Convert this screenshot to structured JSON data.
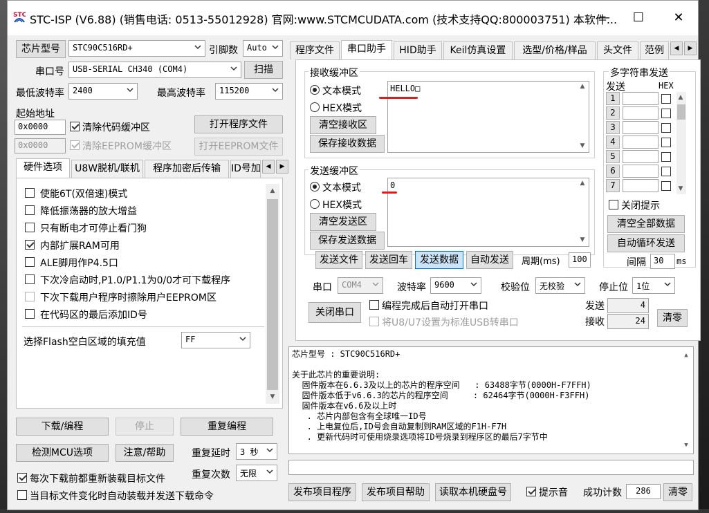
{
  "window": {
    "title": "STC-ISP (V6.88) (销售电话: 0513-55012928) 官网:www.STCMCUDATA.com  (技术支持QQ:800003751) 本软件...",
    "minimize_glyph": "—",
    "maximize_glyph": "☐",
    "close_glyph": "✕"
  },
  "left": {
    "chip_label": "芯片型号",
    "chip_value": "STC90C516RD+",
    "pins_label": "引脚数",
    "pins_value": "Auto",
    "port_label": "串口号",
    "port_value": "USB-SERIAL CH340 (COM4)",
    "scan_button": "扫描",
    "min_baud_label": "最低波特率",
    "min_baud_value": "2400",
    "max_baud_label": "最高波特率",
    "max_baud_value": "115200",
    "start_addr_label": "起始地址",
    "addr1_value": "0x0000",
    "clear_code_label": "清除代码缓冲区",
    "open_program_button": "打开程序文件",
    "addr2_value": "0x0000",
    "clear_eeprom_label": "清除EEPROM缓冲区",
    "open_eeprom_button": "打开EEPROM文件",
    "tabs": [
      "硬件选项",
      "U8W脱机/联机",
      "程序加密后传输",
      "ID号加"
    ],
    "options": [
      {
        "label": "使能6T(双倍速)模式",
        "checked": false,
        "disabled": false
      },
      {
        "label": "降低振荡器的放大增益",
        "checked": false,
        "disabled": false
      },
      {
        "label": "只有断电才可停止看门狗",
        "checked": false,
        "disabled": false
      },
      {
        "label": "内部扩展RAM可用",
        "checked": true,
        "disabled": false
      },
      {
        "label": "ALE脚用作P4.5口",
        "checked": false,
        "disabled": false
      },
      {
        "label": "下次冷启动时,P1.0/P1.1为0/0才可下载程序",
        "checked": false,
        "disabled": false
      },
      {
        "label": "下次下载用户程序时擦除用户EEPROM区",
        "checked": false,
        "disabled": true
      },
      {
        "label": "在代码区的最后添加ID号",
        "checked": false,
        "disabled": false
      }
    ],
    "fill_label": "选择Flash空白区域的填充值",
    "fill_value": "FF",
    "download_button": "下载/编程",
    "stop_button": "停止",
    "reprogram_button": "重复编程",
    "detect_button": "检测MCU选项",
    "help_button": "注意/帮助",
    "repeat_delay_label": "重复延时",
    "repeat_delay_value": "3 秒",
    "repeat_count_label": "重复次数",
    "repeat_count_value": "无限",
    "reload_label": "每次下载前都重新装载目标文件",
    "auto_label": "当目标文件变化时自动装载并发送下载命令"
  },
  "right": {
    "tabs": [
      "程序文件",
      "串口助手",
      "HID助手",
      "Keil仿真设置",
      "选型/价格/样品",
      "头文件",
      "范例"
    ],
    "recv_group": "接收缓冲区",
    "text_mode": "文本模式",
    "hex_mode": "HEX模式",
    "clear_recv": "清空接收区",
    "save_recv": "保存接收数据",
    "recv_text": "HELLO□",
    "send_group": "发送缓冲区",
    "clear_send": "清空发送区",
    "save_send": "保存发送数据",
    "send_text": "0",
    "multi_title": "多字符串发送",
    "multi_send_col": "发送",
    "multi_hex_col": "HEX",
    "multi_rows": [
      "1",
      "2",
      "3",
      "4",
      "5",
      "6",
      "7"
    ],
    "close_hint": "关闭提示",
    "clear_all": "清空全部数据",
    "auto_cycle": "自动循环发送",
    "interval_label": "间隔",
    "interval_value": "30",
    "interval_unit": "ms",
    "send_file": "发送文件",
    "send_return": "发送回车",
    "send_data": "发送数据",
    "auto_send": "自动发送",
    "period_label": "周期(ms)",
    "period_value": "100",
    "serial_label": "串口",
    "serial_value": "COM4",
    "baud_label": "波特率",
    "baud_value": "9600",
    "parity_label": "校验位",
    "parity_value": "无校验",
    "stop_label": "停止位",
    "stop_value": "1位",
    "close_port": "关闭串口",
    "auto_open_label": "编程完成后自动打开串口",
    "usb_label": "将U8/U7设置为标准USB转串口",
    "send_count_label": "发送",
    "send_count": "4",
    "recv_count_label": "接收",
    "recv_count": "24",
    "clear_count": "清零"
  },
  "info": {
    "lines": [
      "芯片型号 : STC90C516RD+",
      "",
      "关于此芯片的重要说明:",
      "  固件版本在6.6.3及以上的芯片的程序空间   : 63488字节(0000H-F7FFH)",
      "  固件版本低于v6.6.3的芯片的程序空间     : 62464字节(0000H-F3FFH)",
      "  固件版本在v6.6及以上时",
      "   . 芯片内部包含有全球唯一ID号",
      "   . 上电复位后,ID号会自动复制到RAM区域的F1H-F7H",
      "   . 更新代码时可使用烧录选项将ID号烧录到程序区的最后7字节中"
    ]
  },
  "bottom": {
    "publish_program": "发布项目程序",
    "publish_help": "发布项目帮助",
    "read_disk": "读取本机硬盘号",
    "beep_label": "提示音",
    "success_label": "成功计数",
    "success_value": "286",
    "clear_button": "清零"
  }
}
